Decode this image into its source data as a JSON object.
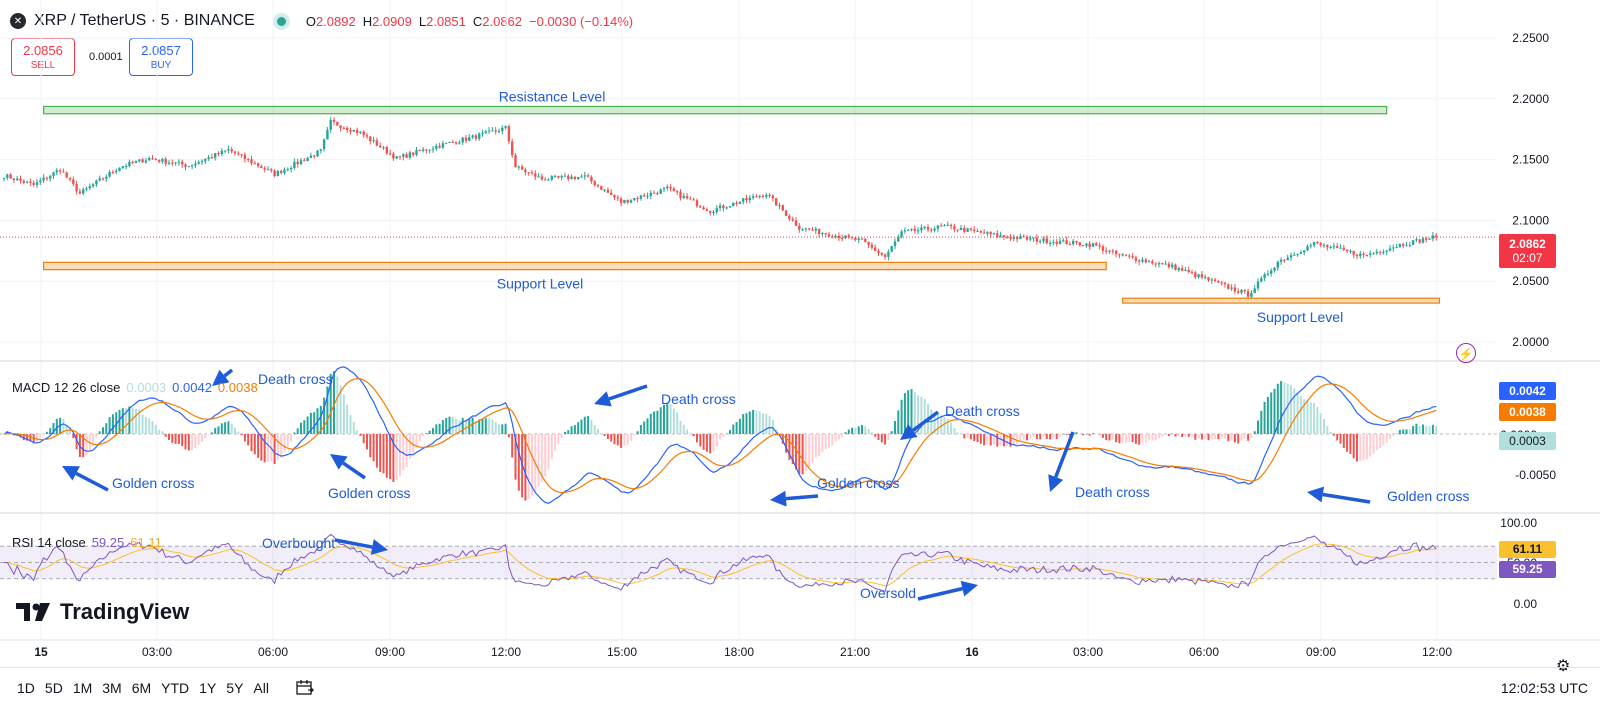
{
  "header": {
    "symbol": "XRP / TetherUS · 5 · BINANCE",
    "ohlc": [
      {
        "key": "O",
        "value": "2.0892"
      },
      {
        "key": "H",
        "value": "2.0909"
      },
      {
        "key": "L",
        "value": "2.0851"
      },
      {
        "key": "C",
        "value": "2.0862"
      }
    ],
    "change": "−0.0030 (−0.14%)"
  },
  "trade": {
    "sell_price": "2.0856",
    "sell_label": "SELL",
    "spread": "0.0001",
    "buy_price": "2.0857",
    "buy_label": "BUY"
  },
  "macd_legend": {
    "label": "MACD 12 26 close",
    "hist": "0.0003",
    "macd": "0.0042",
    "signal": "0.0038"
  },
  "rsi_legend": {
    "label": "RSI 14 close",
    "rsi": "59.25",
    "ma": "61.11"
  },
  "price_tag": {
    "price": "2.0862",
    "countdown": "02:07"
  },
  "brand": "TradingView",
  "ranges": [
    "1D",
    "5D",
    "1M",
    "3M",
    "6M",
    "YTD",
    "1Y",
    "5Y",
    "All"
  ],
  "clock": "12:02:53 UTC",
  "colors": {
    "up": "#26a69a",
    "down": "#ef5350",
    "macd": "#2962ff",
    "signal": "#f57c00",
    "rsi": "#7e57c2",
    "rsi_ma": "#fbc02d",
    "annotation": "#1e5bd8"
  },
  "chart_data": [
    {
      "type": "candlestick",
      "title": "XRP / TetherUS · 5 · BINANCE",
      "x_ticks": [
        "15",
        "03:00",
        "06:00",
        "09:00",
        "12:00",
        "15:00",
        "18:00",
        "21:00",
        "16",
        "03:00",
        "06:00",
        "09:00",
        "12:00"
      ],
      "y_ticks": [
        "2.2500",
        "2.2000",
        "2.1500",
        "2.1000",
        "2.0500",
        "2.0000"
      ],
      "ylim": [
        1.99,
        2.26
      ],
      "close_path": [
        [
          0,
          2.137
        ],
        [
          9,
          2.129
        ],
        [
          17,
          2.142
        ],
        [
          23,
          2.122
        ],
        [
          35,
          2.144
        ],
        [
          44,
          2.151
        ],
        [
          56,
          2.145
        ],
        [
          68,
          2.158
        ],
        [
          82,
          2.138
        ],
        [
          96,
          2.157
        ],
        [
          99,
          2.181
        ],
        [
          108,
          2.172
        ],
        [
          119,
          2.151
        ],
        [
          131,
          2.161
        ],
        [
          143,
          2.169
        ],
        [
          152,
          2.176
        ],
        [
          155,
          2.144
        ],
        [
          163,
          2.134
        ],
        [
          176,
          2.136
        ],
        [
          187,
          2.115
        ],
        [
          201,
          2.126
        ],
        [
          214,
          2.108
        ],
        [
          231,
          2.122
        ],
        [
          241,
          2.094
        ],
        [
          260,
          2.083
        ],
        [
          267,
          2.07
        ],
        [
          272,
          2.09
        ],
        [
          285,
          2.095
        ],
        [
          302,
          2.087
        ],
        [
          317,
          2.083
        ],
        [
          330,
          2.08
        ],
        [
          337,
          2.072
        ],
        [
          354,
          2.062
        ],
        [
          368,
          2.048
        ],
        [
          377,
          2.039
        ],
        [
          386,
          2.066
        ],
        [
          397,
          2.081
        ],
        [
          412,
          2.071
        ],
        [
          423,
          2.08
        ],
        [
          433,
          2.086
        ]
      ],
      "last_close": 2.0862,
      "zones": [
        {
          "label": "Resistance Level",
          "from": 2.1877,
          "to": 2.1937,
          "start_bar": 12,
          "end_bar": 419,
          "color": "#4caf50"
        },
        {
          "label": "Support Level",
          "from": 2.0595,
          "to": 2.0655,
          "start_bar": 12,
          "end_bar": 334,
          "color": "#f57c00"
        },
        {
          "label": "Support Level",
          "from": 2.032,
          "to": 2.036,
          "start_bar": 339,
          "end_bar": 435,
          "color": "#f57c00"
        }
      ]
    },
    {
      "type": "line",
      "title": "MACD 12 26 close",
      "y_ticks": [
        "0.0000",
        "-0.0050"
      ],
      "series": [
        {
          "name": "MACD",
          "color": "#2962ff"
        },
        {
          "name": "Signal",
          "color": "#f57c00"
        }
      ],
      "annotations": [
        "Golden cross",
        "Golden cross",
        "Death cross",
        "Death cross",
        "Golden cross",
        "Death cross",
        "Golden cross",
        "Death cross"
      ]
    },
    {
      "type": "line",
      "title": "RSI 14 close",
      "y_ticks": [
        "100.00",
        "50.00",
        "0.00"
      ],
      "bands": [
        70,
        50,
        30
      ],
      "annotations": [
        "Overbought",
        "Oversold"
      ]
    }
  ]
}
